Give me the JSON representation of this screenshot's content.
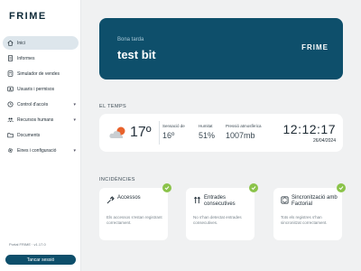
{
  "brand": {
    "logo": "FRIME"
  },
  "sidebar": {
    "items": [
      {
        "label": "Inici",
        "icon": "home-icon"
      },
      {
        "label": "Informes",
        "icon": "document-icon"
      },
      {
        "label": "Simulador de vendes",
        "icon": "calculator-icon"
      },
      {
        "label": "Usuaris i permisos",
        "icon": "user-icon"
      },
      {
        "label": "Control d'accés",
        "icon": "clock-icon"
      },
      {
        "label": "Recursos humans",
        "icon": "people-icon"
      },
      {
        "label": "Documents",
        "icon": "folder-icon"
      },
      {
        "label": "Eines i configuració",
        "icon": "gear-icon"
      }
    ],
    "version": "Portal FRIME · v1.17.0",
    "logout_label": "Tancar sessió"
  },
  "banner": {
    "greeting": "Bona tarda",
    "user": "test bit",
    "logo": "FRIME"
  },
  "weather": {
    "section_title": "EL TEMPS",
    "temperature": "17º",
    "feels_label": "Sensació de",
    "feels_value": "16º",
    "humidity_label": "Humitat",
    "humidity_value": "51%",
    "pressure_label": "Pressió atmosfèrica",
    "pressure_value": "1007mb",
    "time": "12:12:17",
    "date": "26/04/2024",
    "icon": "cloud-sun-icon"
  },
  "incidents": {
    "section_title": "INCIDÈNCIES",
    "cards": [
      {
        "title": "Accessos",
        "text": "Els accessos s'estan registrant correctament.",
        "icon": "access-icon"
      },
      {
        "title": "Entrades consecutives",
        "text": "No s'han detectat entrades consecutives.",
        "icon": "arrows-icon"
      },
      {
        "title": "Sincronització amb Factorial",
        "text": "Tots els registres s'han sincronitzat correctament.",
        "icon": "sync-icon"
      }
    ]
  },
  "colors": {
    "primary": "#0e4f6b",
    "success": "#8bc34a",
    "background": "#f0f1f2"
  }
}
